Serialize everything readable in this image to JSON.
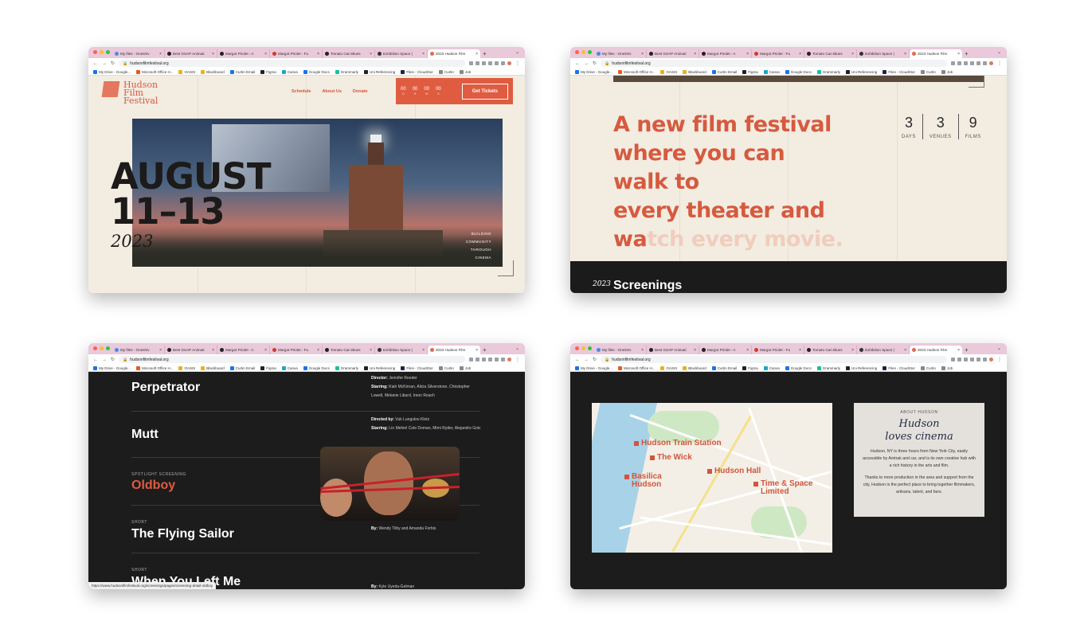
{
  "browser": {
    "tabs": [
      "My files - OneDriv",
      "Best GSAP Animati",
      "Margot Priolet - A",
      "Margot Priolet - Fu",
      "Tomato Can Blues",
      "Exhibition Space |",
      "2023 Hudson Film"
    ],
    "tab_colors": [
      "#4a8be8",
      "#222222",
      "#222222",
      "#d33a2c",
      "#222222",
      "#333333",
      "#e26a4f"
    ],
    "url": "hudsonfilmfestival.org",
    "bookmarks": [
      {
        "label": "My Drive - Google...",
        "color": "#1a73e8"
      },
      {
        "label": "Microsoft Office H...",
        "color": "#e85a1c"
      },
      {
        "label": "OASIS",
        "color": "#e8b21c"
      },
      {
        "label": "Blackboard",
        "color": "#e8b21c"
      },
      {
        "label": "Curtin Email",
        "color": "#1a73e8"
      },
      {
        "label": "Figma",
        "color": "#222222"
      },
      {
        "label": "Canva",
        "color": "#19a8c8"
      },
      {
        "label": "Google Docs",
        "color": "#1a73e8"
      },
      {
        "label": "Grammarly",
        "color": "#15c39a"
      },
      {
        "label": "Uni Referencing",
        "color": "#222222"
      },
      {
        "label": "Files - CloudStor",
        "color": "#222244"
      },
      {
        "label": "Curtin",
        "color": "#888888"
      },
      {
        "label": "Job",
        "color": "#888888"
      }
    ]
  },
  "home": {
    "logo": [
      "Hudson",
      "Film",
      "Festival"
    ],
    "nav": [
      "Schedule",
      "About Us",
      "Donate"
    ],
    "countdown": [
      {
        "value": "00",
        "unit": "D"
      },
      {
        "value": "00",
        "unit": "H"
      },
      {
        "value": "00",
        "unit": "M"
      },
      {
        "value": "00",
        "unit": "S"
      }
    ],
    "ticket_label": "Get Tickets",
    "date_line1": "AUGUST",
    "date_line2": "11–13",
    "year": "2023",
    "side_text": [
      "BUILDING",
      "COMMUNITY",
      "THROUGH",
      "CINEMA"
    ]
  },
  "intro": {
    "tagline_lines": [
      "A new film festival",
      "where you can walk to",
      "every theater and"
    ],
    "tagline_last_solid": "wa",
    "tagline_last_faded": "tch every movie.",
    "stats": [
      {
        "value": "3",
        "label": "DAYS"
      },
      {
        "value": "3",
        "label": "VENUES"
      },
      {
        "value": "9",
        "label": "FILMS"
      }
    ],
    "year": "2023",
    "section_title": "Screenings"
  },
  "screenings": {
    "rows": [
      {
        "kicker": "",
        "title": "Perpetrator",
        "info": [
          [
            "Director:",
            "Jennifer Reeder"
          ],
          [
            "Starring:",
            "Kiah McKirnan, Alicia Silverstone, Christopher Lowell, Melanie Liburd, Ireon Roach"
          ]
        ]
      },
      {
        "kicker": "",
        "title": "Mutt",
        "info": [
          [
            "Directed by:",
            "Vuk Lungulov-Klotz"
          ],
          [
            "Starring:",
            "Lío Mehiel Cole Doman, Mimi Ryder, Alejandro Goic"
          ]
        ]
      },
      {
        "kicker": "SPOTLIGHT SCREENING",
        "title": "Oldboy",
        "info": []
      },
      {
        "kicker": "SHORT",
        "title": "The Flying Sailor",
        "info": [
          [
            "By:",
            "Wendy Tilby and Amanda Forbis"
          ]
        ]
      },
      {
        "kicker": "SHORT",
        "title": "When You Left Me",
        "info": [
          [
            "By:",
            "Kyle Uyeda-Gelman"
          ]
        ]
      }
    ],
    "status_url": "https://www.hudsonfilmfestival.org/screenings/pages/screening-detail-oldboy"
  },
  "about": {
    "map_pins": [
      "Hudson Train Station",
      "The Wick",
      "Basilica Hudson",
      "Hudson Hall",
      "Time & Space Limited"
    ],
    "kicker": "ABOUT HUDSON",
    "heading_1": "Hudson",
    "heading_2": "loves cinema",
    "para1": "Hudson, NY is three hours from New York City, easily accessible by Amtrak and car, and is its own creative hub with a rich history in the arts and film.",
    "para2": "Thanks to more production in the area and support from the city, Hudson is the perfect place to bring together filmmakers, artisans, talent, and fans."
  },
  "colors": {
    "accent": "#df5c40",
    "beige": "#f3ece1",
    "dark": "#1c1c1d",
    "tabbar": "#e9c9da"
  }
}
